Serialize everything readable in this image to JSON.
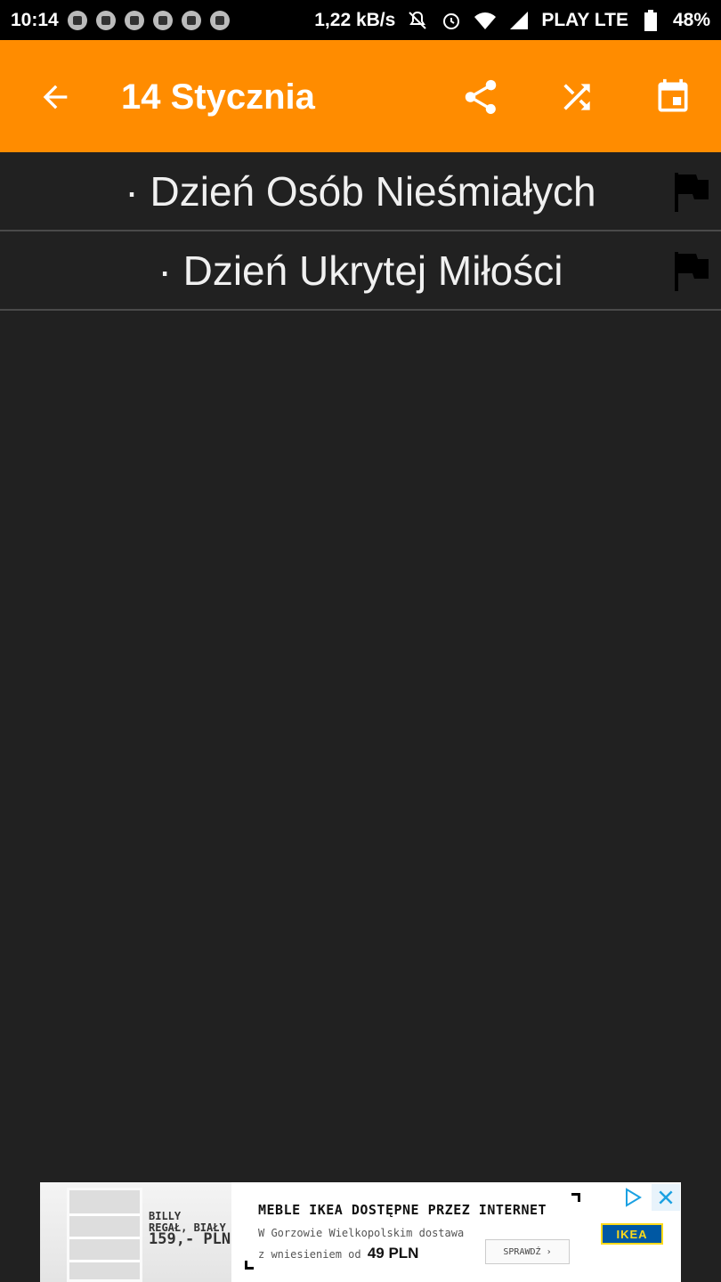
{
  "status_bar": {
    "time": "10:14",
    "speed": "1,22 kB/s",
    "carrier": "PLAY LTE",
    "battery": "48%"
  },
  "app_bar": {
    "title": "14 Stycznia",
    "background_color": "#FF8C00"
  },
  "holidays": [
    {
      "label": "· Dzień Osób Nieśmiałych"
    },
    {
      "label": "· Dzień Ukrytej Miłości"
    }
  ],
  "ad": {
    "product": "BILLY",
    "product_desc": "REGAŁ, BIAŁY",
    "price": "159,- PLN",
    "headline": "MEBLE IKEA DOSTĘPNE PRZEZ INTERNET",
    "line1": "W Gorzowie Wielkopolskim dostawa",
    "line2_prefix": "z wniesieniem od",
    "line2_amount": "49 PLN",
    "cta": "SPRAWDŹ",
    "brand": "IKEA"
  }
}
